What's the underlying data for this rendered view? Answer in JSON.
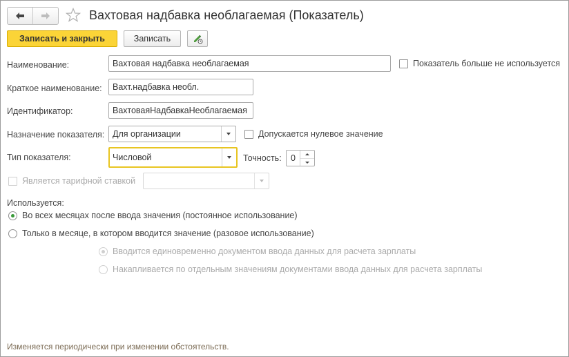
{
  "window": {
    "title": "Вахтовая надбавка необлагаемая (Показатель)"
  },
  "icons": {
    "back": "arrow-left-icon",
    "forward": "arrow-right-icon",
    "favorite": "star-icon",
    "edit": "pencil-edit-icon"
  },
  "toolbar": {
    "save_close_label": "Записать и закрыть",
    "save_label": "Записать"
  },
  "form": {
    "name_label": "Наименование:",
    "name_value": "Вахтовая надбавка необлагаемая",
    "not_used_label": "Показатель больше не используется",
    "not_used_checked": false,
    "short_name_label": "Краткое наименование:",
    "short_name_value": "Вахт.надбавка необл.",
    "identifier_label": "Идентификатор:",
    "identifier_value": "ВахтоваяНадбавкаНеоблагаемая",
    "purpose_label": "Назначение показателя:",
    "purpose_value": "Для организации",
    "zero_allowed_label": "Допускается нулевое значение",
    "zero_allowed_checked": false,
    "type_label": "Тип показателя:",
    "type_value": "Числовой",
    "precision_label": "Точность:",
    "precision_value": "0",
    "tariff_label": "Является тарифной ставкой",
    "tariff_checked": false,
    "tariff_select_value": ""
  },
  "usage": {
    "label": "Используется:",
    "options": [
      {
        "label": "Во всех месяцах после ввода значения (постоянное использование)",
        "checked": true
      },
      {
        "label": "Только в месяце, в котором вводится значение (разовое использование)",
        "checked": false
      }
    ],
    "sub_options": [
      {
        "label": "Вводится единовременно документом ввода данных для расчета зарплаты",
        "checked": true
      },
      {
        "label": "Накапливается по отдельным значениям документами ввода данных для расчета зарплаты",
        "checked": false
      }
    ]
  },
  "footer": {
    "hint": "Изменяется периодически при изменении обстоятельств."
  },
  "colors": {
    "primary_button": "#fbd437",
    "focus_border": "#e8c521",
    "radio_checked": "#3a9a3a",
    "hint_text": "#7a6a53"
  }
}
